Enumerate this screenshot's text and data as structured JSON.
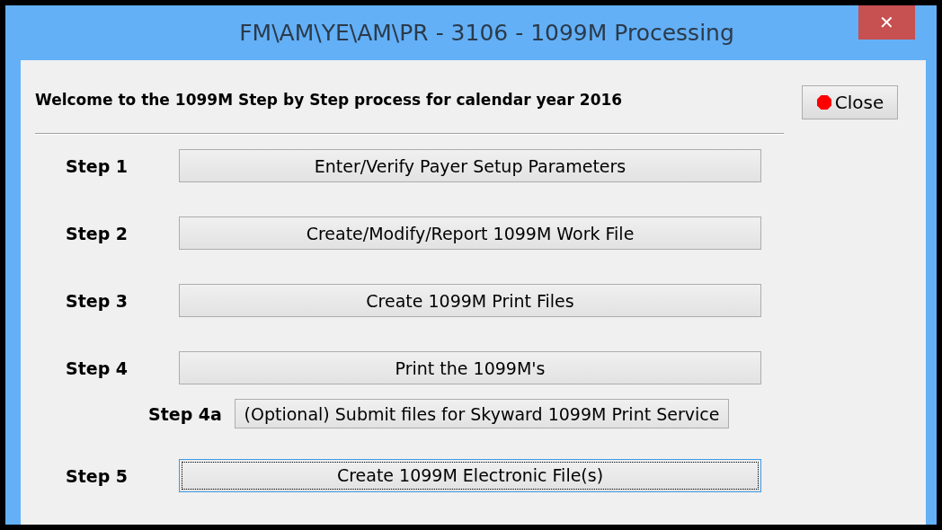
{
  "window": {
    "title": "FM\\AM\\YE\\AM\\PR - 3106 - 1099M Processing",
    "close_glyph": "✕"
  },
  "heading": "Welcome to the 1099M Step by Step process for calendar year 2016",
  "close_button": {
    "label": "Close"
  },
  "steps": [
    {
      "kind": "main",
      "label": "Step 1",
      "button": "Enter/Verify Payer Setup Parameters",
      "focused": false
    },
    {
      "kind": "main",
      "label": "Step 2",
      "button": "Create/Modify/Report 1099M Work File",
      "focused": false
    },
    {
      "kind": "main",
      "label": "Step 3",
      "button": "Create 1099M Print Files",
      "focused": false
    },
    {
      "kind": "main",
      "label": "Step 4",
      "button": "Print the 1099M's",
      "focused": false
    },
    {
      "kind": "sub",
      "label": "Step 4a",
      "button": "(Optional) Submit files for Skyward 1099M Print Service",
      "focused": false
    },
    {
      "kind": "main",
      "label": "Step 5",
      "button": "Create 1099M Electronic File(s)",
      "focused": true
    }
  ]
}
